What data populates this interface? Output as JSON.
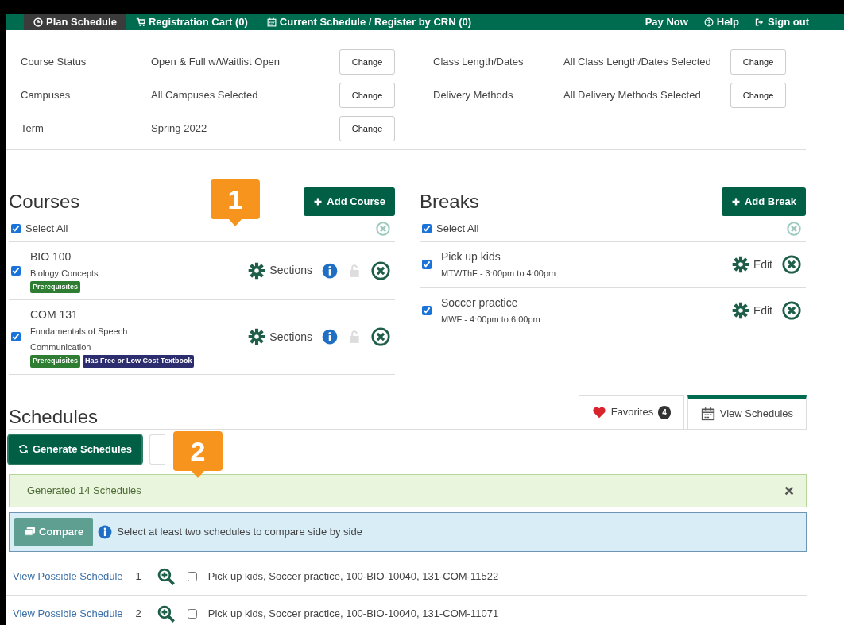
{
  "nav": {
    "items": [
      {
        "label": "Plan Schedule",
        "selected": true
      },
      {
        "label": "Registration Cart (0)",
        "selected": false
      },
      {
        "label": "Current Schedule / Register by CRN (0)",
        "selected": false
      }
    ],
    "right_items": [
      {
        "label": "Pay Now"
      },
      {
        "label": "Help"
      },
      {
        "label": "Sign out"
      }
    ]
  },
  "filters": [
    {
      "label": "Course Status",
      "value": "Open & Full w/Waitlist Open",
      "button": "Change"
    },
    {
      "label": "Class Length/Dates",
      "value": "All Class Length/Dates Selected",
      "button": "Change"
    },
    {
      "label": "Campuses",
      "value": "All Campuses Selected",
      "button": "Change"
    },
    {
      "label": "Delivery Methods",
      "value": "All Delivery Methods Selected",
      "button": "Change"
    },
    {
      "label": "Term",
      "value": "Spring 2022",
      "button": "Change"
    }
  ],
  "courses": {
    "title": "Courses",
    "add_button": "Add Course",
    "select_all": {
      "label": "Select All",
      "checked": true
    },
    "items": [
      {
        "title": "BIO 100",
        "subtitle": "Biology Concepts",
        "checked": true,
        "action": "Sections",
        "badges": [
          {
            "label": "Prerequisites",
            "color": "#2e7d32"
          }
        ]
      },
      {
        "title": "COM 131",
        "subtitle": "Fundamentals of Speech Communication",
        "checked": true,
        "action": "Sections",
        "badges": [
          {
            "label": "Prerequisites",
            "color": "#2e7d32"
          },
          {
            "label": "Has Free or Low Cost Textbook",
            "color": "#2b2d6e"
          }
        ]
      }
    ]
  },
  "breaks": {
    "title": "Breaks",
    "add_button": "Add Break",
    "select_all": {
      "label": "Select All",
      "checked": true
    },
    "items": [
      {
        "title": "Pick up kids",
        "subtitle": "MTWThF - 3:00pm to 4:00pm",
        "checked": true,
        "action": "Edit"
      },
      {
        "title": "Soccer practice",
        "subtitle": "MWF - 4:00pm to 6:00pm",
        "checked": true,
        "action": "Edit"
      }
    ]
  },
  "schedules": {
    "title": "Schedules",
    "tabs": [
      {
        "label": "Favorites",
        "count": "4",
        "selected": false
      },
      {
        "label": "View Schedules",
        "selected": true
      }
    ],
    "generate_button": "Generate Schedules",
    "alert": "Generated 14 Schedules",
    "compare_button": "Compare",
    "compare_hint": "Select at least two schedules to compare side by side",
    "rows": [
      {
        "link": "View Possible Schedule",
        "number": "1",
        "checked": false,
        "description": "Pick up kids, Soccer practice, 100-BIO-10040, 131-COM-11522"
      },
      {
        "link": "View Possible Schedule",
        "number": "2",
        "checked": false,
        "description": "Pick up kids, Soccer practice, 100-BIO-10040, 131-COM-11071"
      }
    ]
  },
  "callouts": [
    {
      "label": "1"
    },
    {
      "label": "2"
    }
  ]
}
